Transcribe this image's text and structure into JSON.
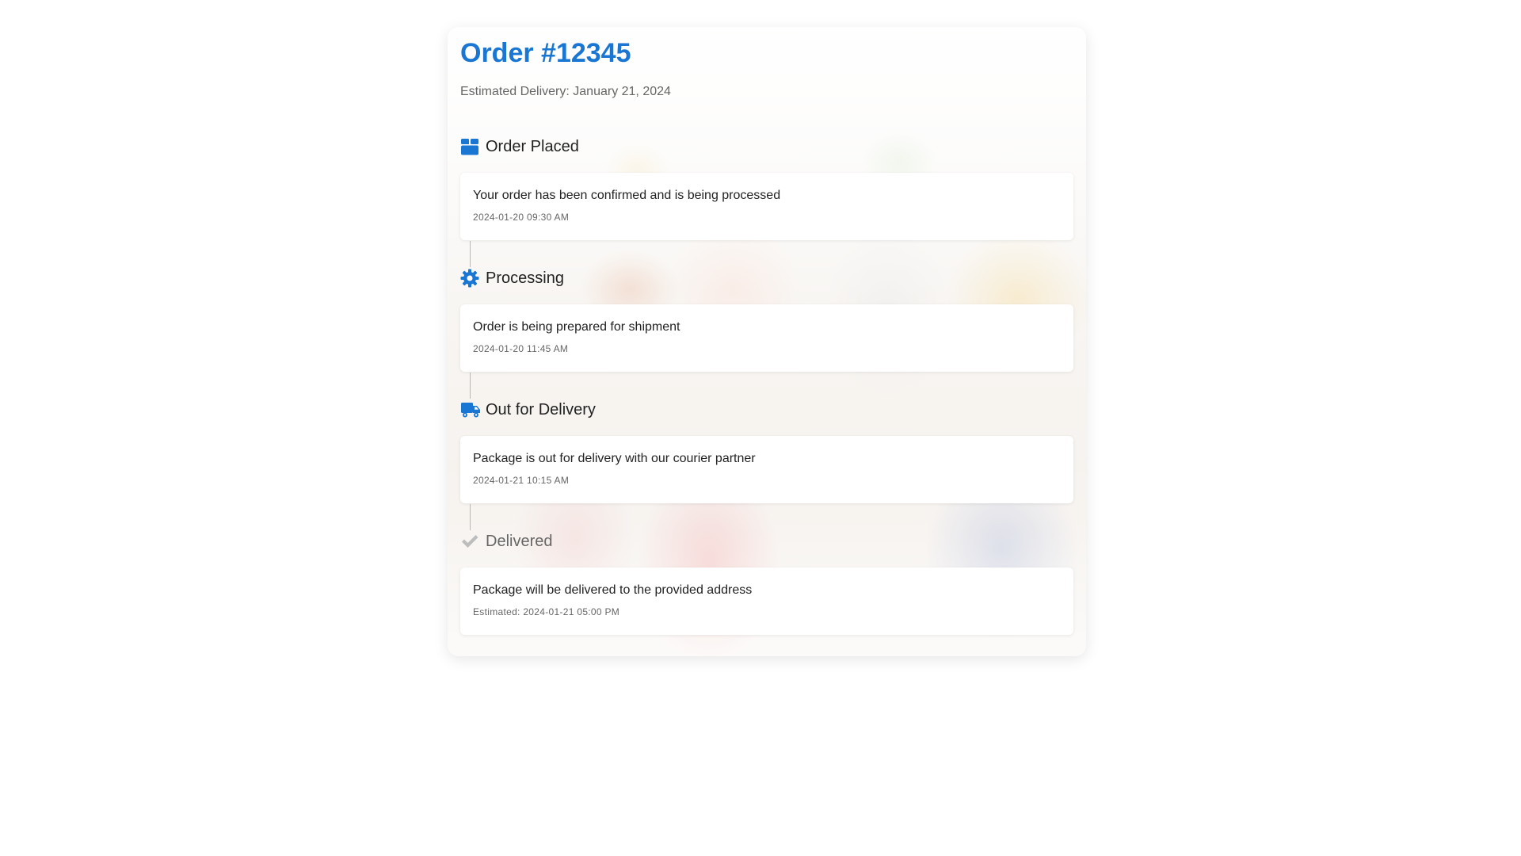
{
  "order": {
    "title": "Order #12345",
    "estimated_delivery": "Estimated Delivery: January 21, 2024"
  },
  "timeline": {
    "steps": [
      {
        "label": "Order Placed",
        "icon": "box-icon",
        "description": "Your order has been confirmed and is being processed",
        "time": "2024-01-20 09:30 AM",
        "status": "completed"
      },
      {
        "label": "Processing",
        "icon": "gear-icon",
        "description": "Order is being prepared for shipment",
        "time": "2024-01-20 11:45 AM",
        "status": "completed"
      },
      {
        "label": "Out for Delivery",
        "icon": "truck-icon",
        "description": "Package is out for delivery with our courier partner",
        "time": "2024-01-21 10:15 AM",
        "status": "completed"
      },
      {
        "label": "Delivered",
        "icon": "check-icon",
        "description": "Package will be delivered to the provided address",
        "time": "Estimated: 2024-01-21 05:00 PM",
        "status": "pending"
      }
    ]
  },
  "colors": {
    "accent": "#1976d2",
    "pending_icon": "#bdbdbd",
    "muted_text": "#666666"
  }
}
